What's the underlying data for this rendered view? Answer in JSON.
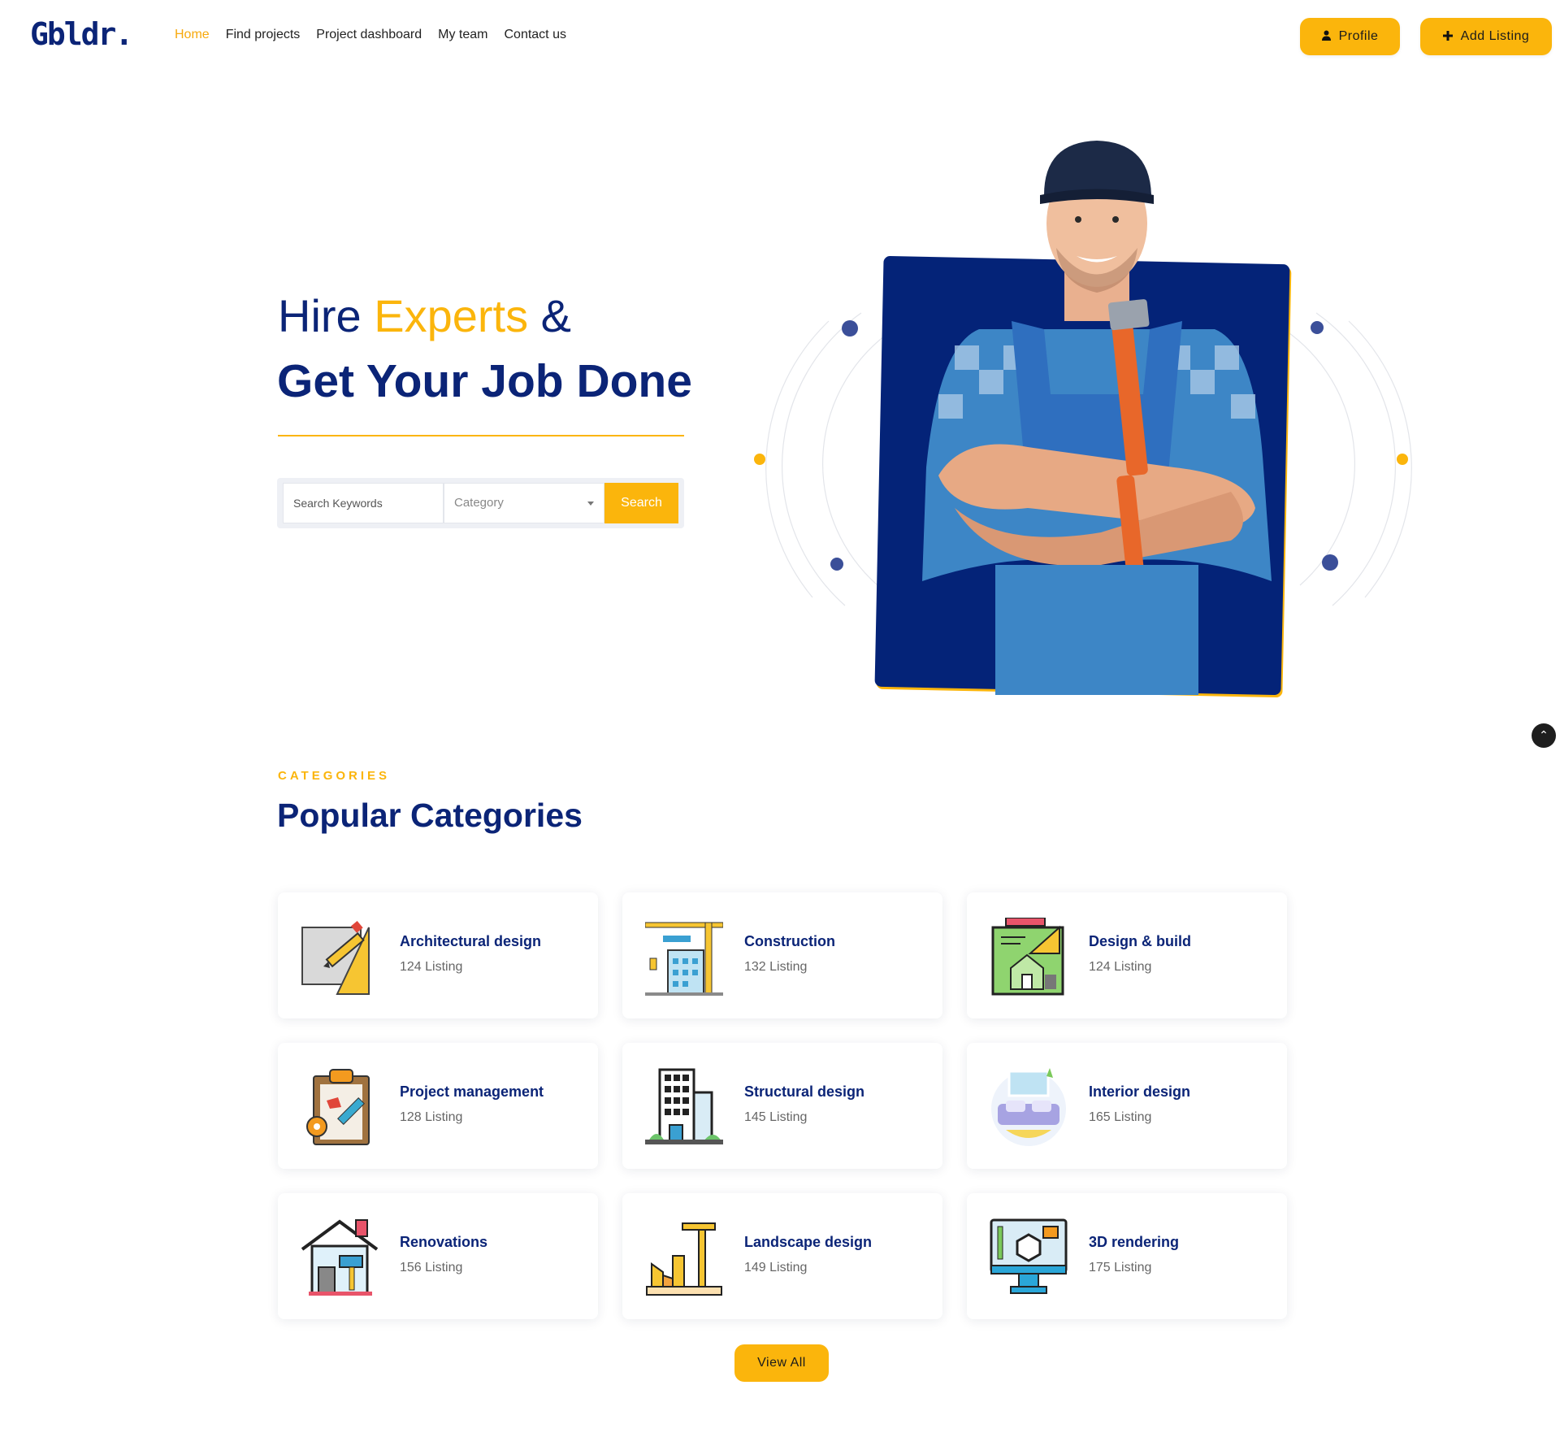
{
  "header": {
    "logo": "Gbldr.",
    "nav": [
      "Home",
      "Find projects",
      "Project dashboard",
      "My team",
      "Contact us"
    ],
    "profile_label": "Profile",
    "add_label": "Add Listing"
  },
  "hero": {
    "line1_a": "Hire ",
    "line1_b": "Experts",
    "line1_c": " &",
    "line2": "Get Your Job Done",
    "search": {
      "keywords_placeholder": "Search Keywords",
      "category_value": "Category",
      "button_label": "Search"
    }
  },
  "categories": {
    "kicker": "CATEGORIES",
    "title": "Popular Categories",
    "items": [
      {
        "name": "Architectural design",
        "count": "124 Listing",
        "icon": "blueprint-pencil-icon"
      },
      {
        "name": "Construction",
        "count": "132 Listing",
        "icon": "crane-building-icon"
      },
      {
        "name": "Design & build",
        "count": "124 Listing",
        "icon": "house-plan-icon"
      },
      {
        "name": "Project management",
        "count": "128 Listing",
        "icon": "clipboard-gear-icon"
      },
      {
        "name": "Structural design",
        "count": "145 Listing",
        "icon": "office-building-icon"
      },
      {
        "name": "Interior design",
        "count": "165 Listing",
        "icon": "sofa-icon"
      },
      {
        "name": "Renovations",
        "count": "156 Listing",
        "icon": "house-paint-icon"
      },
      {
        "name": "Landscape design",
        "count": "149 Listing",
        "icon": "construction-site-icon"
      },
      {
        "name": "3D rendering",
        "count": "175 Listing",
        "icon": "monitor-cube-icon"
      }
    ],
    "view_all": "View All"
  },
  "colors": {
    "primary": "#0b2477",
    "accent": "#fbb50c"
  }
}
